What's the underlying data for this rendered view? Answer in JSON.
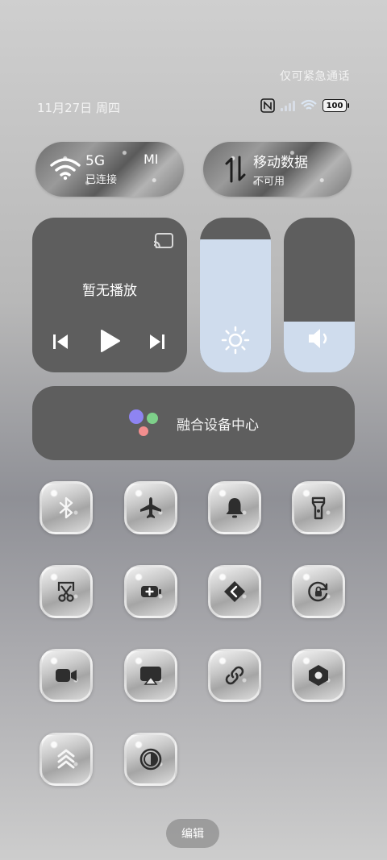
{
  "header": {
    "emergency_text": "仅可紧急通话",
    "date": "11月27日",
    "weekday": "周四",
    "battery": "100"
  },
  "wifi_tile": {
    "title": "5G",
    "subtitle": "已连接",
    "extra": "MI"
  },
  "mobile_tile": {
    "title": "移动数据",
    "subtitle": "不可用"
  },
  "media": {
    "title": "暂无播放"
  },
  "sliders": {
    "brightness_level": 0.86,
    "volume_level": 0.33
  },
  "hub": {
    "label": "融合设备中心"
  },
  "toggles": [
    {
      "icon": "bluetooth-icon"
    },
    {
      "icon": "airplane-icon"
    },
    {
      "icon": "bell-icon"
    },
    {
      "icon": "flashlight-icon"
    },
    {
      "icon": "screenshot-icon"
    },
    {
      "icon": "battery-saver-icon"
    },
    {
      "icon": "transfer-icon"
    },
    {
      "icon": "rotation-lock-icon"
    },
    {
      "icon": "screen-record-icon"
    },
    {
      "icon": "cast-icon"
    },
    {
      "icon": "link-icon"
    },
    {
      "icon": "settings-hex-icon"
    },
    {
      "icon": "performance-icon"
    },
    {
      "icon": "dark-mode-icon"
    }
  ],
  "footer": {
    "edit_label": "编辑"
  },
  "colors": {
    "panel": "#5e5e5e",
    "slider_fill": "#cfdced"
  }
}
